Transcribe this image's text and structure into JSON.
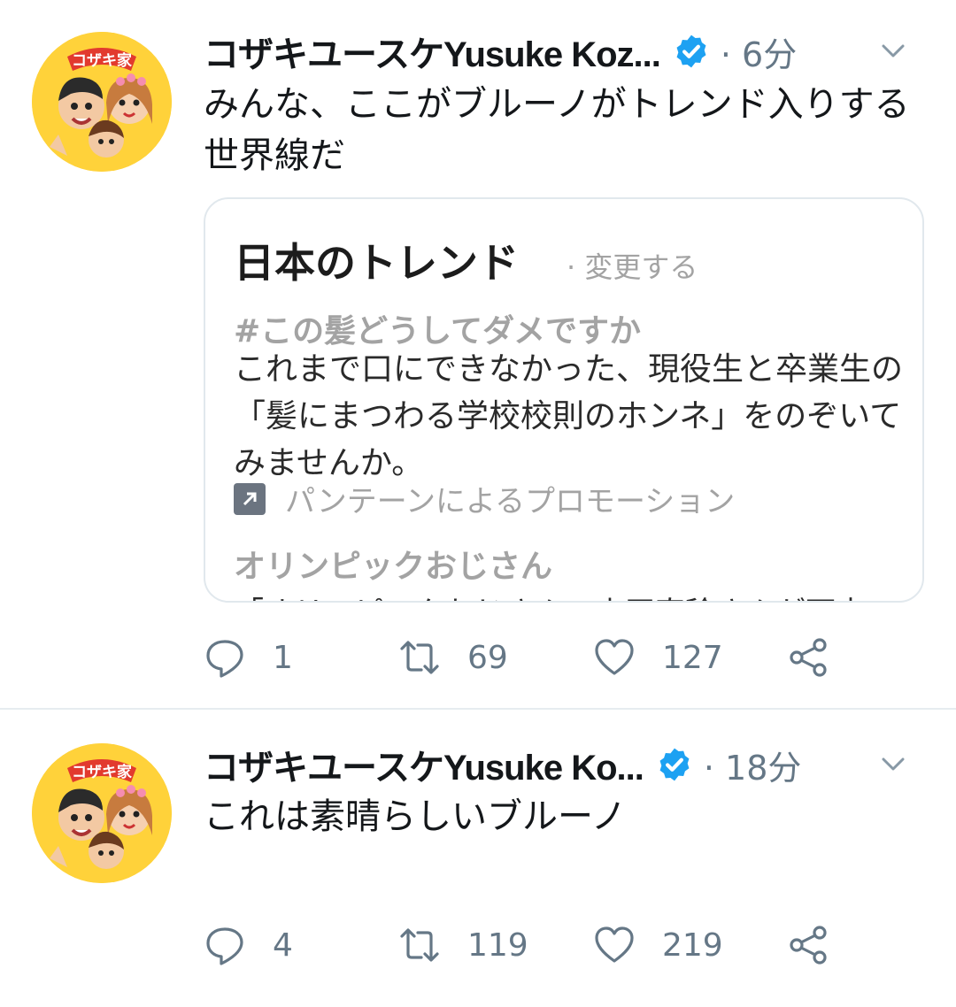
{
  "tweets": [
    {
      "display_name": "コザキユースケYusuke Koz...",
      "time": "· 6分",
      "text": "みんな、ここがブルーノがトレンド入りする世界線だ",
      "card": {
        "title": "日本のトレンド",
        "change": "· 変更する",
        "trends": [
          {
            "name": "#この髪どうしてダメですか",
            "description": "これまで口にできなかった、現役生と卒業生の「髪にまつわる学校校則のホンネ」をのぞいてみませんか。",
            "promoted": "パンテーンによるプロモーション"
          },
          {
            "name": "オリンピックおじさん",
            "description": "「オリンピックおじさん」山田直稔さんが死去"
          }
        ]
      },
      "counts": {
        "reply": "1",
        "retweet": "69",
        "like": "127"
      }
    },
    {
      "display_name": "コザキユースケYusuke Ko...",
      "time": "· 18分",
      "text": "これは素晴らしいブルーノ",
      "counts": {
        "reply": "4",
        "retweet": "119",
        "like": "219"
      }
    }
  ],
  "avatar_badge": "コザキ家",
  "colors": {
    "verified": "#1da1f2",
    "muted": "#657786",
    "divider": "#e6ecf0",
    "card_border": "#e1e8ed"
  }
}
